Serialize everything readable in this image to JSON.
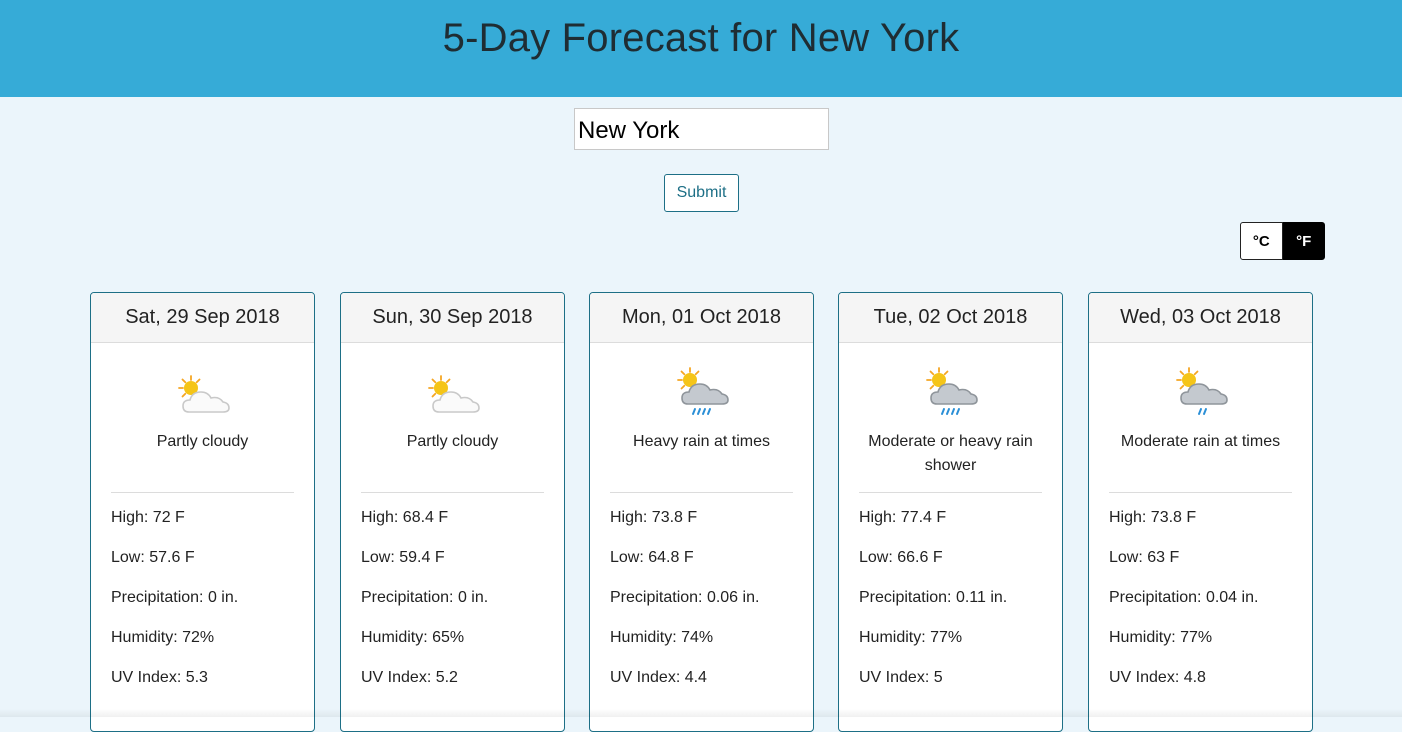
{
  "header": {
    "title": "5-Day Forecast for New York"
  },
  "search": {
    "value": "New York",
    "submit_label": "Submit"
  },
  "units": {
    "celsius": "°C",
    "fahrenheit": "°F",
    "selected": "°F"
  },
  "days": [
    {
      "date": "Sat, 29 Sep 2018",
      "icon": "partly-cloudy-icon",
      "condition": "Partly cloudy",
      "high": "High: 72 F",
      "low": "Low: 57.6 F",
      "precip": "Precipitation: 0 in.",
      "humidity": "Humidity: 72%",
      "uv": "UV Index: 5.3"
    },
    {
      "date": "Sun, 30 Sep 2018",
      "icon": "partly-cloudy-icon",
      "condition": "Partly cloudy",
      "high": "High: 68.4 F",
      "low": "Low: 59.4 F",
      "precip": "Precipitation: 0 in.",
      "humidity": "Humidity: 65%",
      "uv": "UV Index: 5.2"
    },
    {
      "date": "Mon, 01 Oct 2018",
      "icon": "heavy-rain-icon",
      "condition": "Heavy rain at times",
      "high": "High: 73.8 F",
      "low": "Low: 64.8 F",
      "precip": "Precipitation: 0.06 in.",
      "humidity": "Humidity: 74%",
      "uv": "UV Index: 4.4"
    },
    {
      "date": "Tue, 02 Oct 2018",
      "icon": "heavy-rain-shower-icon",
      "condition": "Moderate or heavy rain shower",
      "high": "High: 77.4 F",
      "low": "Low: 66.6 F",
      "precip": "Precipitation: 0.11 in.",
      "humidity": "Humidity: 77%",
      "uv": "UV Index: 5"
    },
    {
      "date": "Wed, 03 Oct 2018",
      "icon": "moderate-rain-icon",
      "condition": "Moderate rain at times",
      "high": "High: 73.8 F",
      "low": "Low: 63 F",
      "precip": "Precipitation: 0.04 in.",
      "humidity": "Humidity: 77%",
      "uv": "UV Index: 4.8"
    }
  ],
  "colors": {
    "header_bg": "#36abd7",
    "page_bg": "#ebf5fb",
    "accent": "#1d6f86",
    "sun": "#f5c518",
    "rain": "#2a8fd6"
  }
}
